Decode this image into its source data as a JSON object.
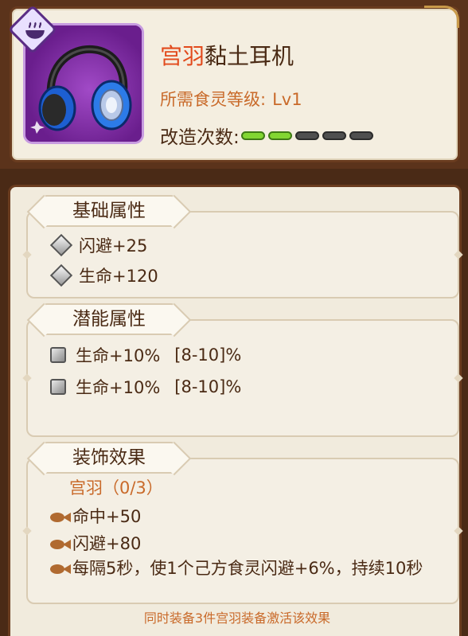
{
  "item": {
    "set_name": "宫羽",
    "name_rest": "黏土耳机",
    "level_label": "所需食灵等级:",
    "level_value": "Lv1",
    "refine_label": "改造次数:",
    "refine_count": 2,
    "refine_max": 5,
    "icon": "headphones-icon",
    "badge_icon": "food-bowl-icon"
  },
  "basic": {
    "title": "基础属性",
    "stats": [
      "闪避+25",
      "生命+120"
    ]
  },
  "potential": {
    "title": "潜能属性",
    "stats": [
      {
        "value": "生命+10%",
        "range": "[8-10]%"
      },
      {
        "value": "生命+10%",
        "range": "[8-10]%"
      }
    ]
  },
  "set": {
    "title": "装饰效果",
    "set_progress": "宫羽（0/3）",
    "effects": [
      "命中+50",
      "闪避+80",
      "每隔5秒，使1个己方食灵闪避+6%，持续10秒"
    ],
    "note": "同时装备3件宫羽装备激活该效果"
  },
  "colors": {
    "rarity_purple": "#7a2aa0",
    "set_name_red": "#e24a1c",
    "accent_orange": "#c96a2a",
    "pip_green": "#82d632"
  }
}
